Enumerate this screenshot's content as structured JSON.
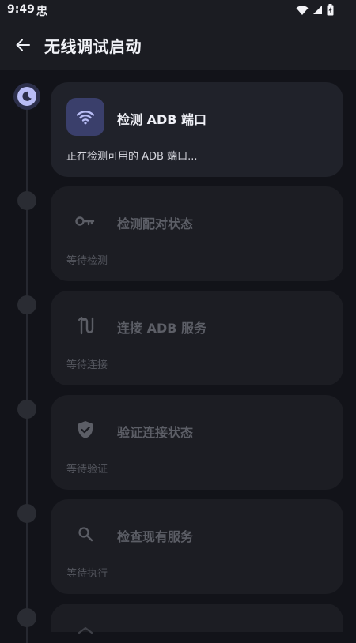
{
  "status_bar": {
    "time": "9:49",
    "notification": "忠",
    "icons": [
      "wifi-icon",
      "signal-icon",
      "battery-icon"
    ]
  },
  "app_bar": {
    "back_icon": "arrow-left-icon",
    "title": "无线调试启动"
  },
  "steps": [
    {
      "title": "检测 ADB 端口",
      "subtitle": "正在检测可用的 ADB 端口...",
      "icon": "wifi-icon",
      "state": "active"
    },
    {
      "title": "检测配对状态",
      "subtitle": "等待检测",
      "icon": "key-icon",
      "state": "pending"
    },
    {
      "title": "连接 ADB 服务",
      "subtitle": "等待连接",
      "icon": "route-icon",
      "state": "pending"
    },
    {
      "title": "验证连接状态",
      "subtitle": "等待验证",
      "icon": "shield-check-icon",
      "state": "pending"
    },
    {
      "title": "检查现有服务",
      "subtitle": "等待执行",
      "icon": "search-icon",
      "state": "pending"
    }
  ],
  "colors": {
    "background": "#121319",
    "card": "#1c1d23",
    "active_card": "#20222a",
    "accent": "#b9bdf6",
    "active_icon_bg": "#3a3f6b",
    "pending_text": "#5c5e66"
  }
}
